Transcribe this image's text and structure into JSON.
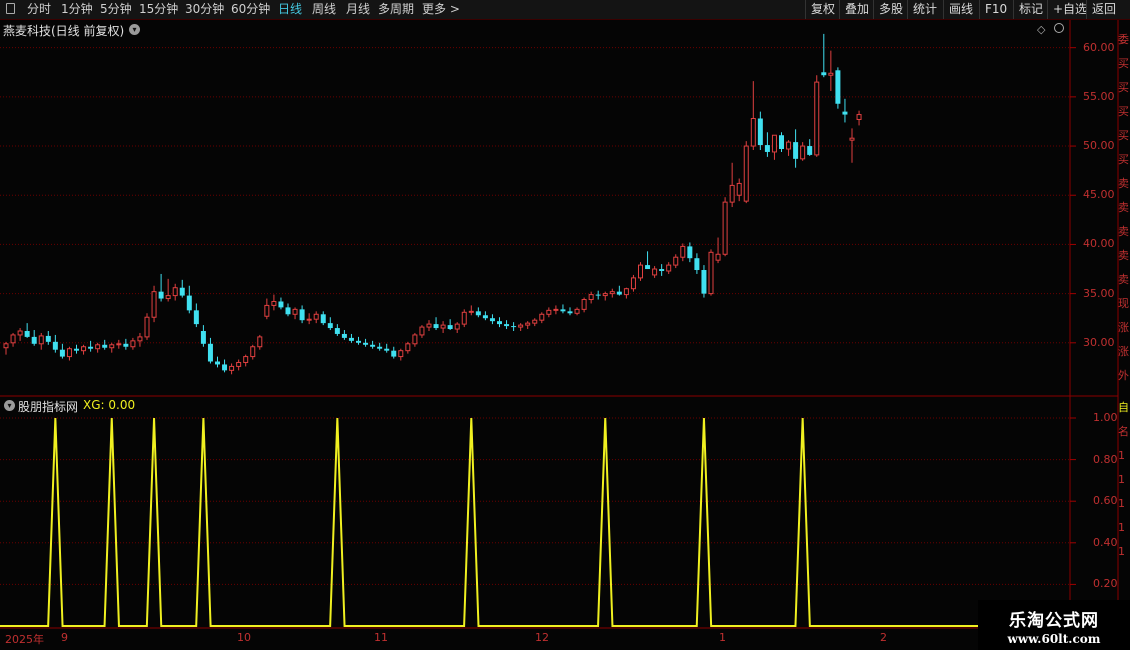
{
  "toolbar": {
    "periods": [
      "分时",
      "1分钟",
      "5分钟",
      "15分钟",
      "30分钟",
      "60分钟",
      "日线",
      "周线",
      "月线",
      "多周期",
      "更多 >"
    ],
    "active_period": "日线",
    "right_buttons": [
      "复权",
      "叠加",
      "多股",
      "统计",
      "画线",
      "F10",
      "标记",
      "+自选",
      "返回"
    ]
  },
  "price_pane": {
    "title": "燕麦科技(日线 前复权)",
    "y_ticks": [
      "60.00",
      "55.00",
      "50.00",
      "45.00",
      "40.00",
      "35.00",
      "30.00"
    ],
    "side_chars": [
      "委",
      "买",
      "买",
      "买",
      "买",
      "买",
      "卖",
      "卖",
      "卖",
      "卖",
      "卖",
      "现",
      "涨",
      "涨",
      "外",
      "换",
      "净",
      "收"
    ]
  },
  "indicator_pane": {
    "title": "股朋指标网",
    "value_label": "XG: 0.00",
    "y_ticks": [
      "1.00",
      "0.80",
      "0.60",
      "0.40",
      "0.20"
    ],
    "side_chars": [
      "自",
      "名",
      "1",
      "1",
      "1",
      "1",
      "1"
    ]
  },
  "x_axis": {
    "labels": [
      "2025年",
      "9",
      "10",
      "11",
      "12",
      "1",
      "2"
    ]
  },
  "watermark": {
    "main": "乐淘公式网",
    "sub": "www.60lt.com"
  },
  "colors": {
    "up": "#e04040",
    "down": "#40e0f0",
    "indicator": "#f0f020",
    "grid": "#6a0000",
    "active": "#44c8e0"
  },
  "chart_data": [
    {
      "type": "candlestick",
      "title": "燕麦科技(日线 前复权)",
      "ylim": [
        25.0,
        62.0
      ],
      "x": [
        "2025-08",
        "2025-09",
        "2025-10",
        "2025-11",
        "2025-12",
        "2026-01",
        "2026-02"
      ],
      "candles": [
        [
          29.5,
          30.1,
          28.8,
          29.9
        ],
        [
          30.0,
          31.0,
          29.6,
          30.8
        ],
        [
          30.8,
          31.5,
          30.2,
          31.2
        ],
        [
          31.2,
          32.0,
          30.5,
          30.6
        ],
        [
          30.6,
          31.3,
          29.7,
          29.9
        ],
        [
          29.9,
          31.0,
          29.3,
          30.7
        ],
        [
          30.7,
          31.2,
          29.8,
          30.1
        ],
        [
          30.1,
          30.8,
          29.0,
          29.3
        ],
        [
          29.3,
          29.9,
          28.4,
          28.6
        ],
        [
          28.6,
          29.6,
          28.2,
          29.4
        ],
        [
          29.4,
          29.8,
          28.9,
          29.2
        ],
        [
          29.2,
          29.8,
          28.8,
          29.6
        ],
        [
          29.6,
          30.2,
          29.1,
          29.4
        ],
        [
          29.4,
          30.0,
          29.0,
          29.8
        ],
        [
          29.8,
          30.3,
          29.3,
          29.5
        ],
        [
          29.5,
          30.0,
          29.0,
          29.8
        ],
        [
          29.8,
          30.3,
          29.4,
          29.9
        ],
        [
          29.9,
          30.4,
          29.3,
          29.6
        ],
        [
          29.6,
          30.5,
          29.3,
          30.2
        ],
        [
          30.2,
          31.0,
          29.6,
          30.6
        ],
        [
          30.6,
          33.0,
          30.3,
          32.6
        ],
        [
          32.6,
          35.8,
          32.1,
          35.2
        ],
        [
          35.2,
          37.0,
          34.2,
          34.5
        ],
        [
          34.5,
          36.5,
          34.2,
          34.8
        ],
        [
          34.8,
          36.0,
          34.3,
          35.6
        ],
        [
          35.6,
          36.4,
          34.6,
          34.8
        ],
        [
          34.8,
          35.8,
          33.0,
          33.3
        ],
        [
          33.3,
          34.0,
          31.6,
          31.9
        ],
        [
          31.2,
          31.8,
          29.6,
          29.9
        ],
        [
          29.9,
          30.5,
          27.9,
          28.1
        ],
        [
          28.1,
          28.6,
          27.5,
          27.8
        ],
        [
          27.8,
          28.3,
          27.0,
          27.2
        ],
        [
          27.2,
          27.9,
          26.8,
          27.6
        ],
        [
          27.6,
          28.3,
          27.2,
          28.0
        ],
        [
          28.0,
          28.8,
          27.6,
          28.6
        ],
        [
          28.6,
          29.8,
          28.3,
          29.6
        ],
        [
          29.6,
          30.8,
          29.3,
          30.6
        ],
        [
          32.7,
          34.5,
          32.4,
          33.8
        ],
        [
          33.8,
          34.9,
          33.3,
          34.2
        ],
        [
          34.2,
          34.6,
          33.4,
          33.6
        ],
        [
          33.6,
          34.0,
          32.7,
          32.9
        ],
        [
          32.9,
          33.6,
          32.4,
          33.4
        ],
        [
          33.4,
          33.8,
          32.0,
          32.3
        ],
        [
          32.3,
          33.0,
          31.9,
          32.4
        ],
        [
          32.4,
          33.2,
          32.0,
          32.9
        ],
        [
          32.9,
          33.2,
          31.8,
          32.0
        ],
        [
          32.0,
          32.6,
          31.3,
          31.5
        ],
        [
          31.5,
          31.9,
          30.7,
          30.9
        ],
        [
          30.9,
          31.3,
          30.3,
          30.5
        ],
        [
          30.5,
          30.9,
          30.0,
          30.2
        ],
        [
          30.2,
          30.6,
          29.8,
          30.0
        ],
        [
          30.0,
          30.4,
          29.6,
          29.8
        ],
        [
          29.8,
          30.2,
          29.4,
          29.6
        ],
        [
          29.6,
          30.0,
          29.2,
          29.4
        ],
        [
          29.4,
          29.9,
          29.0,
          29.2
        ],
        [
          29.2,
          29.6,
          28.4,
          28.6
        ],
        [
          28.6,
          29.4,
          28.2,
          29.2
        ],
        [
          29.2,
          30.1,
          28.9,
          29.9
        ],
        [
          29.9,
          31.0,
          29.6,
          30.8
        ],
        [
          30.8,
          31.8,
          30.5,
          31.6
        ],
        [
          31.6,
          32.3,
          31.2,
          31.9
        ],
        [
          31.9,
          32.6,
          31.3,
          31.5
        ],
        [
          31.5,
          32.2,
          31.0,
          31.8
        ],
        [
          31.8,
          32.4,
          31.3,
          31.4
        ],
        [
          31.4,
          32.1,
          31.0,
          31.9
        ],
        [
          31.9,
          33.4,
          31.6,
          33.1
        ],
        [
          33.1,
          33.8,
          32.8,
          33.2
        ],
        [
          33.2,
          33.6,
          32.6,
          32.8
        ],
        [
          32.8,
          33.2,
          32.3,
          32.5
        ],
        [
          32.5,
          32.9,
          31.9,
          32.2
        ],
        [
          32.2,
          32.6,
          31.6,
          31.9
        ],
        [
          31.9,
          32.3,
          31.4,
          31.7
        ],
        [
          31.7,
          32.1,
          31.2,
          31.6
        ],
        [
          31.6,
          32.0,
          31.2,
          31.8
        ],
        [
          31.8,
          32.2,
          31.4,
          32.0
        ],
        [
          32.0,
          32.5,
          31.7,
          32.3
        ],
        [
          32.3,
          33.1,
          32.0,
          32.9
        ],
        [
          32.9,
          33.6,
          32.6,
          33.3
        ],
        [
          33.3,
          33.8,
          32.9,
          33.4
        ],
        [
          33.4,
          33.9,
          33.0,
          33.2
        ],
        [
          33.2,
          33.6,
          32.8,
          33.0
        ],
        [
          33.0,
          33.6,
          32.8,
          33.4
        ],
        [
          33.4,
          34.6,
          33.1,
          34.4
        ],
        [
          34.4,
          35.2,
          34.0,
          34.9
        ],
        [
          34.9,
          35.3,
          34.4,
          34.8
        ],
        [
          34.8,
          35.2,
          34.3,
          35.0
        ],
        [
          35.0,
          35.5,
          34.6,
          35.2
        ],
        [
          35.2,
          35.8,
          34.8,
          34.9
        ],
        [
          34.9,
          35.6,
          34.5,
          35.5
        ],
        [
          35.5,
          36.9,
          35.2,
          36.6
        ],
        [
          36.6,
          38.2,
          36.3,
          37.9
        ],
        [
          37.9,
          39.3,
          37.5,
          37.5
        ],
        [
          36.9,
          37.8,
          36.6,
          37.5
        ],
        [
          37.5,
          38.0,
          36.8,
          37.3
        ],
        [
          37.3,
          38.2,
          37.0,
          37.9
        ],
        [
          37.9,
          39.0,
          37.6,
          38.7
        ],
        [
          38.7,
          40.1,
          38.3,
          39.8
        ],
        [
          39.8,
          40.2,
          38.2,
          38.6
        ],
        [
          38.6,
          39.1,
          37.0,
          37.4
        ],
        [
          37.4,
          37.9,
          34.6,
          35.0
        ],
        [
          35.0,
          39.5,
          34.8,
          39.2
        ],
        [
          38.4,
          40.7,
          38.1,
          39.0
        ],
        [
          39.0,
          44.8,
          38.8,
          44.3
        ],
        [
          44.3,
          48.3,
          43.8,
          46.0
        ],
        [
          45.0,
          46.7,
          44.4,
          46.2
        ],
        [
          44.4,
          50.5,
          44.2,
          50.0
        ],
        [
          50.0,
          56.6,
          49.6,
          52.8
        ],
        [
          52.8,
          53.5,
          49.6,
          50.1
        ],
        [
          50.1,
          51.4,
          48.9,
          49.4
        ],
        [
          49.4,
          50.3,
          48.6,
          51.1
        ],
        [
          51.1,
          51.4,
          49.4,
          49.7
        ],
        [
          49.7,
          50.6,
          49.0,
          50.4
        ],
        [
          50.4,
          51.7,
          47.8,
          48.7
        ],
        [
          48.7,
          50.4,
          48.5,
          50.0
        ],
        [
          50.0,
          50.7,
          49.0,
          49.1
        ],
        [
          49.1,
          57.2,
          48.9,
          56.5
        ],
        [
          57.5,
          61.4,
          57.0,
          57.2
        ],
        [
          57.2,
          59.7,
          55.6,
          57.4
        ],
        [
          57.7,
          58.0,
          53.8,
          54.3
        ],
        [
          53.5,
          54.8,
          52.4,
          53.2
        ],
        [
          50.6,
          51.8,
          48.3,
          50.8
        ],
        [
          52.7,
          53.6,
          52.1,
          53.2
        ]
      ]
    },
    {
      "type": "line",
      "title": "股朋指标网",
      "series": [
        {
          "name": "XG",
          "values_at_peaks": [
            1,
            1,
            1,
            1,
            1,
            1,
            1,
            1,
            1
          ]
        }
      ],
      "peak_dates_index": [
        7,
        15,
        21,
        28,
        47,
        66,
        85,
        99,
        113
      ],
      "ylim": [
        0,
        1.0
      ],
      "current_value": 0.0
    }
  ]
}
